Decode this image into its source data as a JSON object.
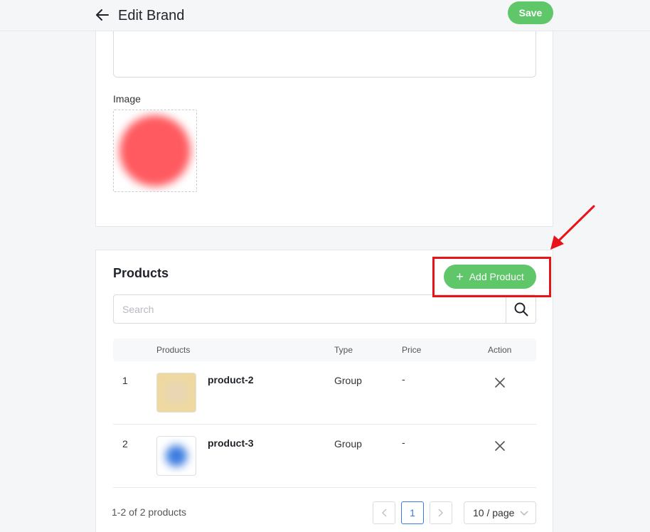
{
  "header": {
    "title": "Edit Brand",
    "save_label": "Save"
  },
  "details": {
    "image_label": "Image"
  },
  "products": {
    "title": "Products",
    "add_label": "Add Product",
    "search_placeholder": "Search",
    "columns": {
      "products": "Products",
      "type": "Type",
      "price": "Price",
      "action": "Action"
    },
    "rows": [
      {
        "index": "1",
        "name": "product-2",
        "type": "Group",
        "price": "-"
      },
      {
        "index": "2",
        "name": "product-3",
        "type": "Group",
        "price": "-"
      }
    ],
    "count_text": "1-2 of 2 products",
    "current_page": "1",
    "page_size": "10 / page"
  },
  "colors": {
    "accent_green": "#5fc66a",
    "highlight_red": "#e8141a",
    "page_blue": "#3a7be0"
  }
}
